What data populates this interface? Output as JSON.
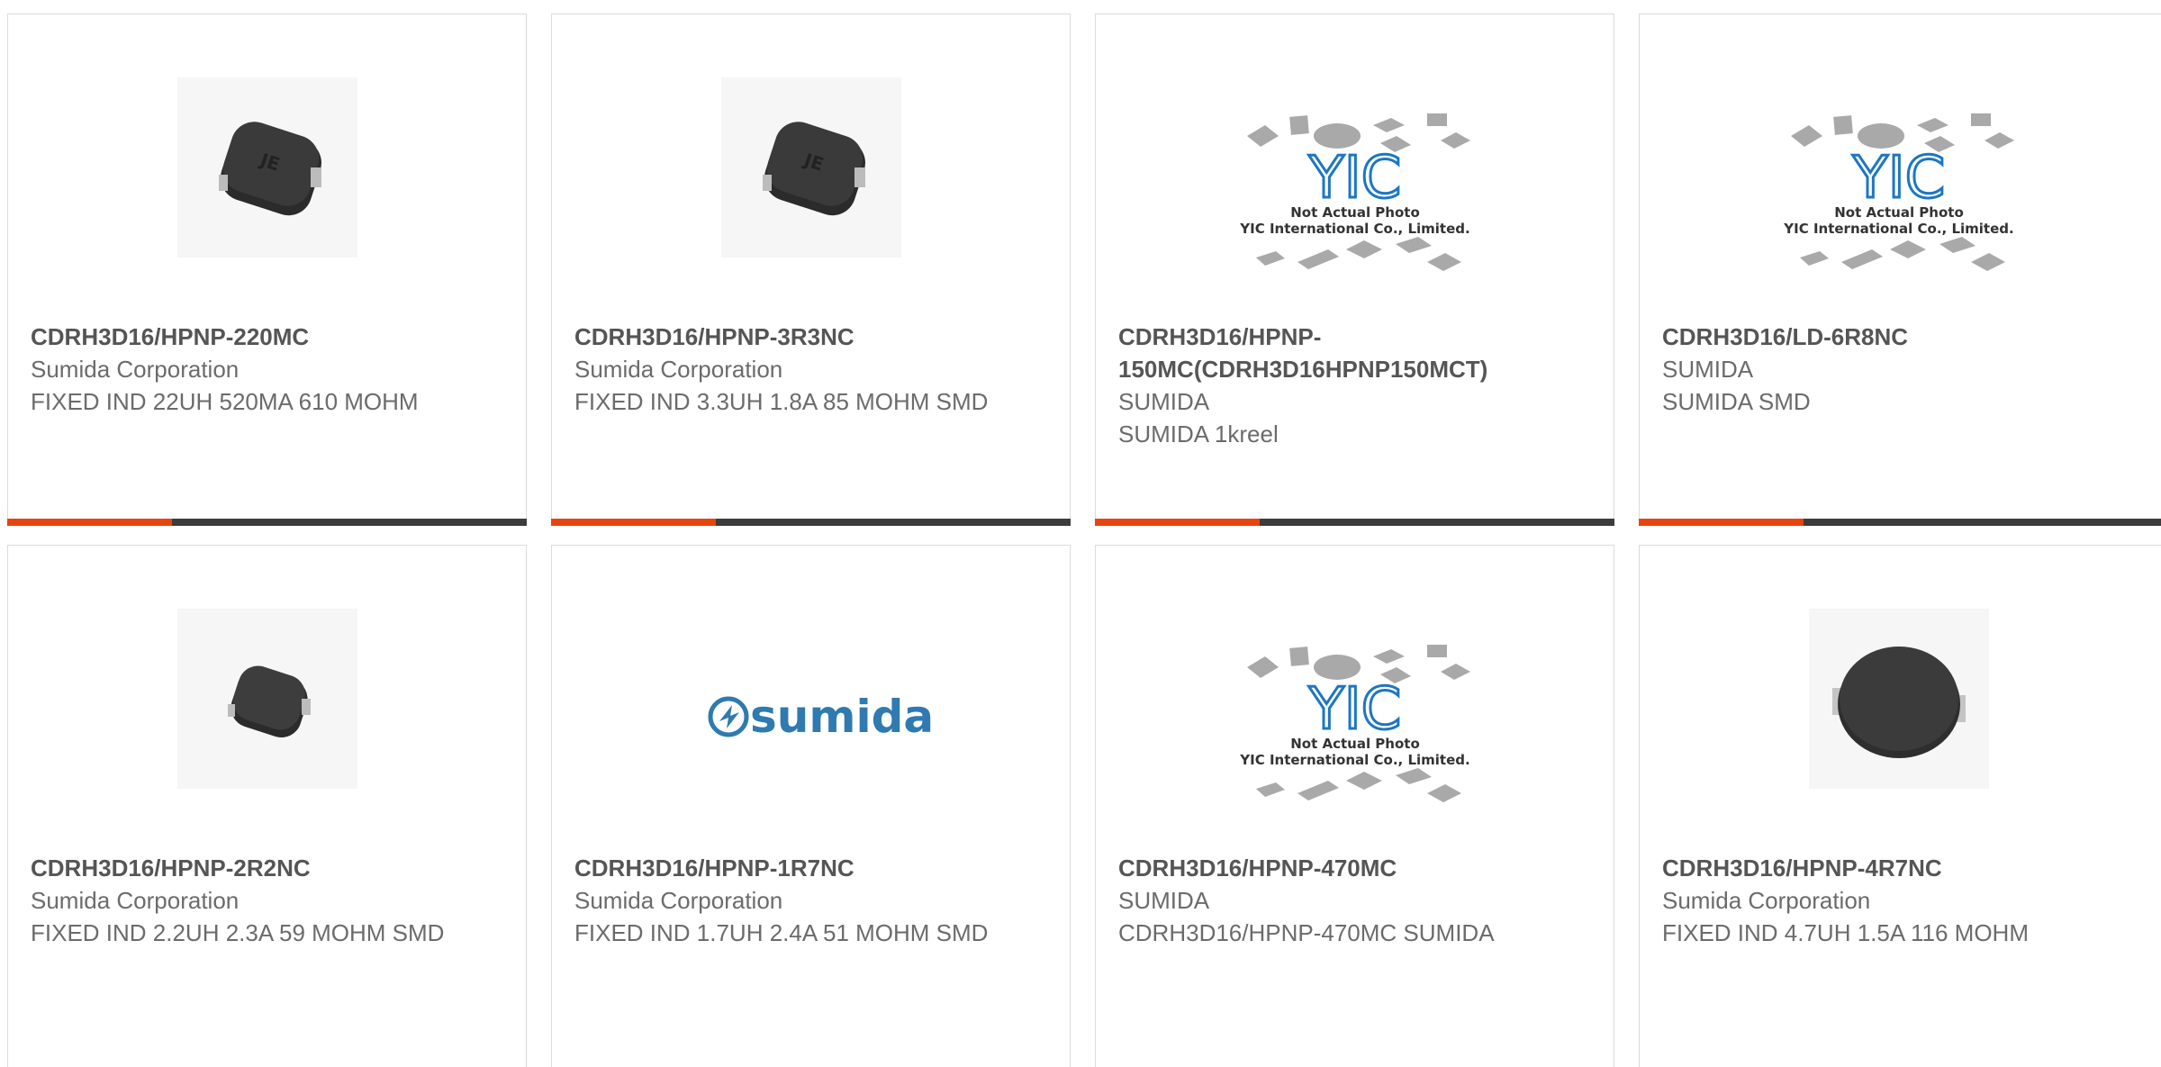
{
  "products": [
    {
      "pn_prefix": "CDRH3D16",
      "pn_suffix": "/HPNP-220MC",
      "manufacturer": "Sumida Corporation",
      "desc": "FIXED IND 22UH 520MA 610 MOHM",
      "image": "inductor-je-photo"
    },
    {
      "pn_prefix": "CDRH3D16",
      "pn_suffix": "/HPNP-3R3NC",
      "manufacturer": "Sumida Corporation",
      "desc": "FIXED IND 3.3UH 1.8A 85 MOHM SMD",
      "image": "inductor-je-photo"
    },
    {
      "pn_prefix": "CDRH3D16",
      "pn_suffix": "/HPNP-150MC(CDRH3D16HPNP150MCT)",
      "manufacturer": "SUMIDA",
      "desc": "SUMIDA 1kreel",
      "image": "yic-not-actual-photo"
    },
    {
      "pn_prefix": "CDRH3D16",
      "pn_suffix": "/LD-6R8NC",
      "manufacturer": "SUMIDA",
      "desc": "SUMIDA SMD",
      "image": "yic-not-actual-photo"
    },
    {
      "pn_prefix": "CDRH3D16",
      "pn_suffix": "/HPNP-2R2NC",
      "manufacturer": "Sumida Corporation",
      "desc": "FIXED IND 2.2UH 2.3A 59 MOHM SMD",
      "image": "inductor-small-photo"
    },
    {
      "pn_prefix": "CDRH3D16",
      "pn_suffix": "/HPNP-1R7NC",
      "manufacturer": "Sumida Corporation",
      "desc": "FIXED IND 1.7UH 2.4A 51 MOHM SMD",
      "image": "sumida-logo"
    },
    {
      "pn_prefix": "CDRH3D16",
      "pn_suffix": "/HPNP-470MC",
      "manufacturer": "SUMIDA",
      "desc": "CDRH3D16/HPNP-470MC SUMIDA",
      "image": "yic-not-actual-photo"
    },
    {
      "pn_prefix": "CDRH3D16",
      "pn_suffix": "/HPNP-4R7NC",
      "manufacturer": "Sumida Corporation",
      "desc": "FIXED IND 4.7UH 1.5A 116 MOHM",
      "image": "inductor-large-photo"
    }
  ],
  "placeholder": {
    "brand": "YIC",
    "line1": "Not Actual Photo",
    "line2": "YIC International Co., Limited."
  },
  "logo_text": "sumida",
  "inductor_marking": "JE",
  "colors": {
    "accent": "#e7440f",
    "bar": "#3c3c3c",
    "yic_blue": "#1d76c2",
    "sumida_blue": "#2f7ab0"
  }
}
